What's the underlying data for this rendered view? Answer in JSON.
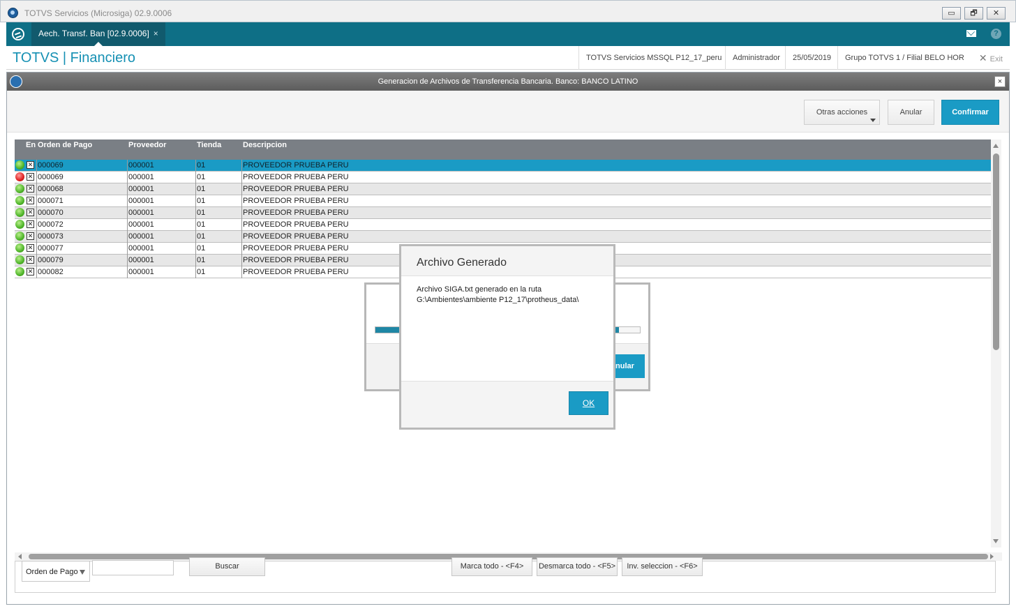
{
  "window": {
    "title": "TOTVS Servicios (Microsiga) 02.9.0006",
    "minimize_label": "▭",
    "restore_label": "🗗",
    "close_label": "✕"
  },
  "tabs": [
    {
      "label": "Aech. Transf. Ban [02.9.0006]",
      "close": "×",
      "active": true
    }
  ],
  "header": {
    "brand": "TOTVS | Financiero",
    "environment": "TOTVS Servicios MSSQL P12_17_peru",
    "user": "Administrador",
    "date": "25/05/2019",
    "branch": "Grupo TOTVS 1 / Filial BELO HOR",
    "exit_label": "Exit"
  },
  "dialog": {
    "title": "Generacion de Archivos de Transferencia Bancaria. Banco: BANCO LATINO",
    "close_label": "×",
    "toolbar": {
      "otras_acciones": "Otras acciones",
      "anular": "Anular",
      "confirmar": "Confirmar"
    }
  },
  "grid": {
    "columns": [
      "En",
      "Orden de Pago",
      "Proveedor",
      "Tienda",
      "Descripcion"
    ],
    "rows": [
      {
        "status": "green",
        "checked": true,
        "orden": "000069",
        "proveedor": "000001",
        "tienda": "01",
        "descripcion": "PROVEEDOR PRUEBA PERU",
        "selected": true
      },
      {
        "status": "red",
        "checked": true,
        "orden": "000069",
        "proveedor": "000001",
        "tienda": "01",
        "descripcion": "PROVEEDOR PRUEBA PERU"
      },
      {
        "status": "green",
        "checked": true,
        "orden": "000068",
        "proveedor": "000001",
        "tienda": "01",
        "descripcion": "PROVEEDOR PRUEBA PERU"
      },
      {
        "status": "green",
        "checked": true,
        "orden": "000071",
        "proveedor": "000001",
        "tienda": "01",
        "descripcion": "PROVEEDOR PRUEBA PERU"
      },
      {
        "status": "green",
        "checked": true,
        "orden": "000070",
        "proveedor": "000001",
        "tienda": "01",
        "descripcion": "PROVEEDOR PRUEBA PERU"
      },
      {
        "status": "green",
        "checked": true,
        "orden": "000072",
        "proveedor": "000001",
        "tienda": "01",
        "descripcion": "PROVEEDOR PRUEBA PERU"
      },
      {
        "status": "green",
        "checked": true,
        "orden": "000073",
        "proveedor": "000001",
        "tienda": "01",
        "descripcion": "PROVEEDOR PRUEBA PERU"
      },
      {
        "status": "green",
        "checked": true,
        "orden": "000077",
        "proveedor": "000001",
        "tienda": "01",
        "descripcion": "PROVEEDOR PRUEBA PERU"
      },
      {
        "status": "green",
        "checked": true,
        "orden": "000079",
        "proveedor": "000001",
        "tienda": "01",
        "descripcion": "PROVEEDOR PRUEBA PERU"
      },
      {
        "status": "green",
        "checked": true,
        "orden": "000082",
        "proveedor": "000001",
        "tienda": "01",
        "descripcion": "PROVEEDOR PRUEBA PERU"
      }
    ]
  },
  "search": {
    "order_select": "Orden de Pago",
    "input_value": "",
    "buscar": "Buscar",
    "marca_todo": "Marca todo - <F4>",
    "desmarca_todo": "Desmarca todo - <F5>",
    "inv_seleccion": "Inv. seleccion - <F6>"
  },
  "progress_dialog": {
    "progress": 0.92,
    "button_partial": "nular"
  },
  "modal": {
    "title": "Archivo Generado",
    "message_line1": "Archivo SIGA.txt generado en la ruta",
    "message_line2": "G:\\Ambientes\\ambiente P12_17\\protheus_data\\",
    "ok_label": "OK"
  },
  "colors": {
    "accent": "#1a9bc5",
    "tabbar": "#0e6f86",
    "brand": "#1590b3",
    "header_grid": "#7a7f85"
  }
}
